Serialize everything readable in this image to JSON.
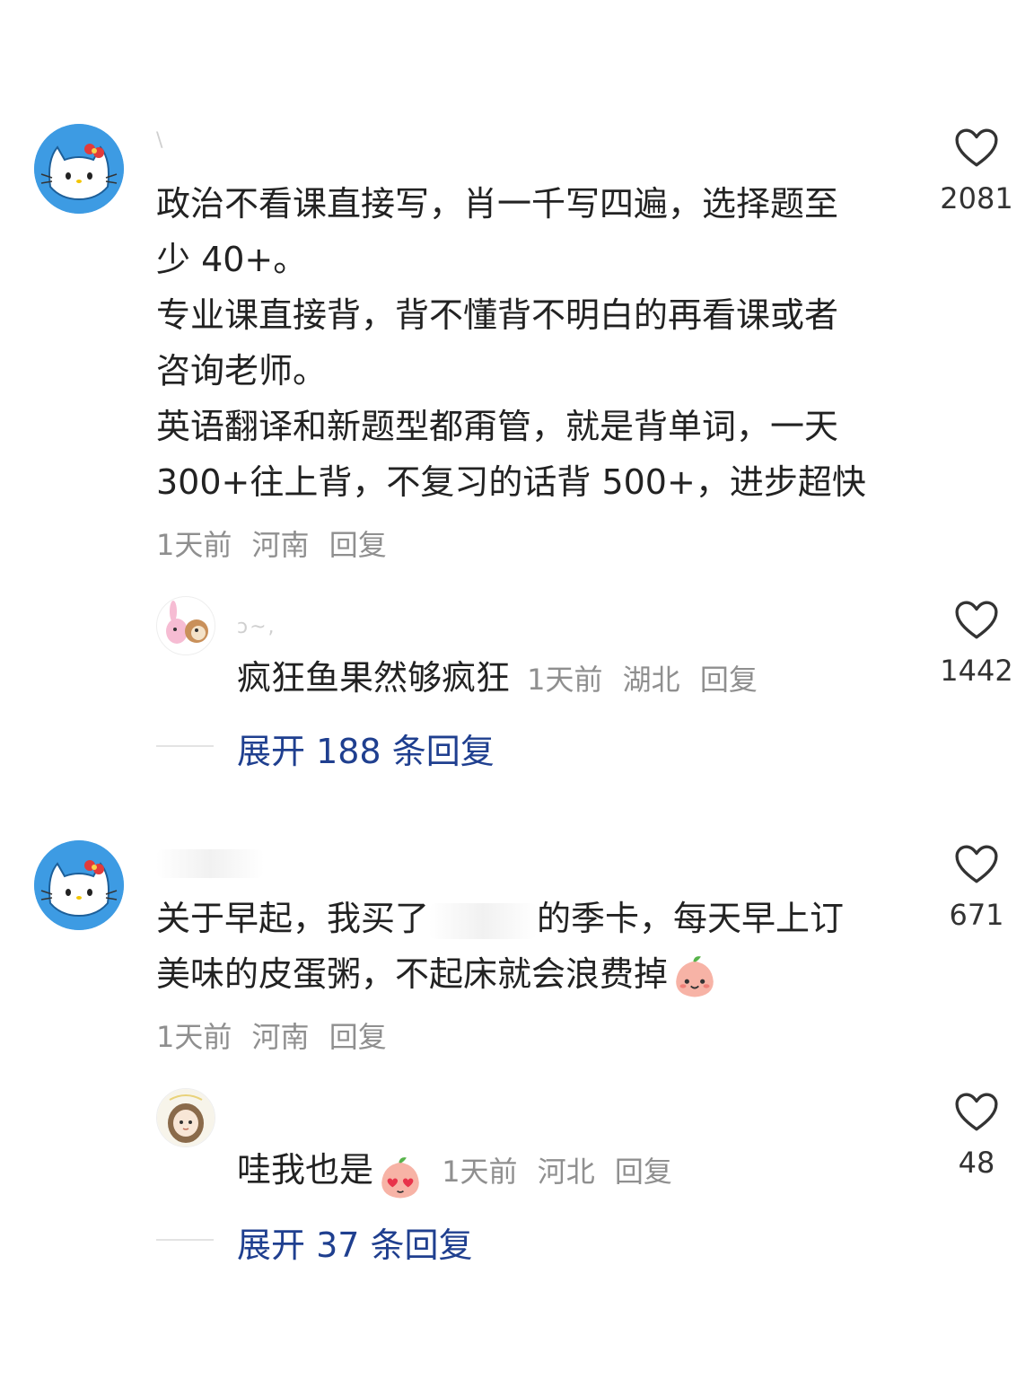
{
  "comments": [
    {
      "username": "\\",
      "lines": [
        "政治不看课直接写，肖一千写四遍，选择题至",
        "少 40+。",
        "专业课直接背，背不懂背不明白的再看课或者",
        "咨询老师。",
        "英语翻译和新题型都甭管，就是背单词，一天",
        "300+往上背，不复习的话背 500+，进步超快"
      ],
      "time": "1天前",
      "location": "河南",
      "reply_label": "回复",
      "likes": "2081",
      "avatar_icon": "hello-kitty-avatar-icon",
      "reply": {
        "username": "ɔ~,",
        "text": "疯狂鱼果然够疯狂",
        "time": "1天前",
        "location": "湖北",
        "reply_label": "回复",
        "likes": "1442",
        "avatar_icon": "cartoon-pair-avatar-icon"
      },
      "expand_label": "展开 188 条回复"
    },
    {
      "username": "",
      "line1_before": "关于早起，我买了",
      "line1_after": "的季卡，每天早上订",
      "line2": "美味的皮蛋粥，不起床就会浪费掉",
      "emoji_icon": "peach-smile-emoji-icon",
      "time": "1天前",
      "location": "河南",
      "reply_label": "回复",
      "likes": "671",
      "avatar_icon": "hello-kitty-avatar-icon",
      "reply": {
        "username": "",
        "text": "哇我也是",
        "emoji_icon": "peach-heart-eyes-emoji-icon",
        "time": "1天前",
        "location": "河北",
        "reply_label": "回复",
        "likes": "48",
        "avatar_icon": "girl-avatar-icon"
      },
      "expand_label": "展开 37 条回复"
    }
  ],
  "colors": {
    "link": "#1f3f8f",
    "meta": "#8f8f8f",
    "text": "#222222",
    "avatar_bg": "#3d9be3"
  }
}
